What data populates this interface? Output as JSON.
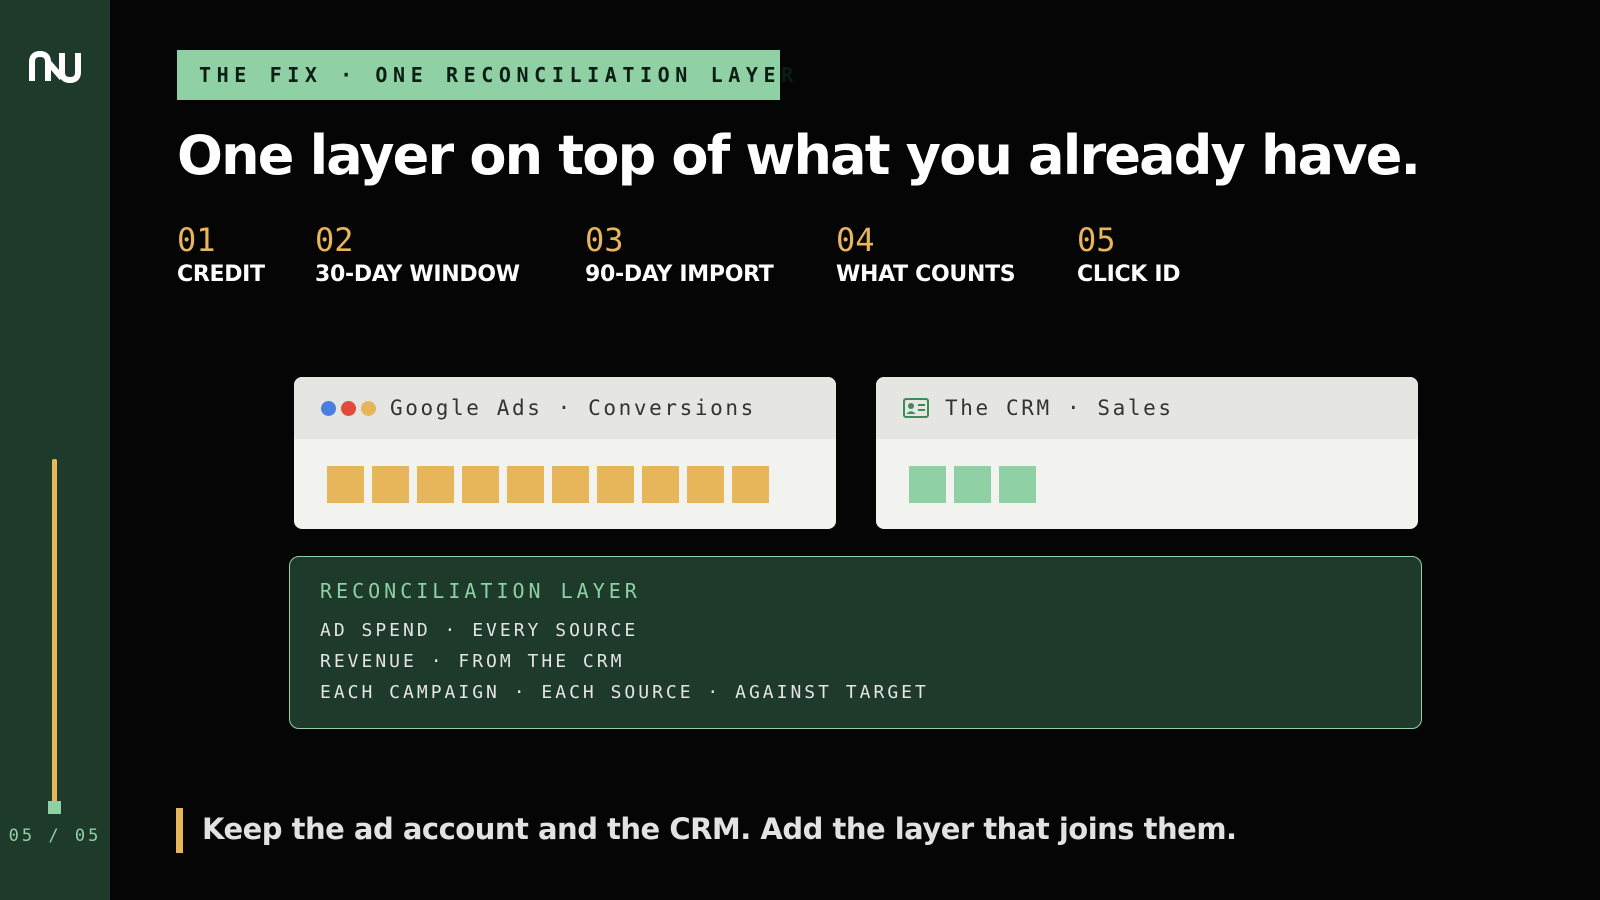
{
  "sidebar": {
    "slide_counter": "05 / 05",
    "progress": 1.0
  },
  "eyebrow": "THE FIX · ONE RECONCILIATION LAYER",
  "headline": "One layer on top of what you already have.",
  "steps": [
    {
      "num": "01",
      "label": "CREDIT"
    },
    {
      "num": "02",
      "label": "30-DAY WINDOW"
    },
    {
      "num": "03",
      "label": "90-DAY IMPORT"
    },
    {
      "num": "04",
      "label": "WHAT COUNTS"
    },
    {
      "num": "05",
      "label": "CLICK ID"
    }
  ],
  "cards": {
    "ads": {
      "title": "Google Ads · Conversions",
      "dot_colors": [
        "#4a7ee0",
        "#e24b3b",
        "#e8b65a"
      ],
      "block_count": 10,
      "block_color": "#e8b65a"
    },
    "crm": {
      "title": "The CRM · Sales",
      "block_count": 3,
      "block_color": "#8fd0a4"
    }
  },
  "reconciliation": {
    "title": "RECONCILIATION LAYER",
    "lines": [
      "AD SPEND · EVERY SOURCE",
      "REVENUE · FROM THE CRM",
      "EACH CAMPAIGN · EACH SOURCE · AGAINST TARGET"
    ]
  },
  "quote": "Keep the ad account and the CRM. Add the layer that joins them.",
  "colors": {
    "accent_green": "#8fd0a4",
    "accent_gold": "#e8b65a",
    "sidebar_bg": "#1e3a2a",
    "background": "#050505"
  }
}
